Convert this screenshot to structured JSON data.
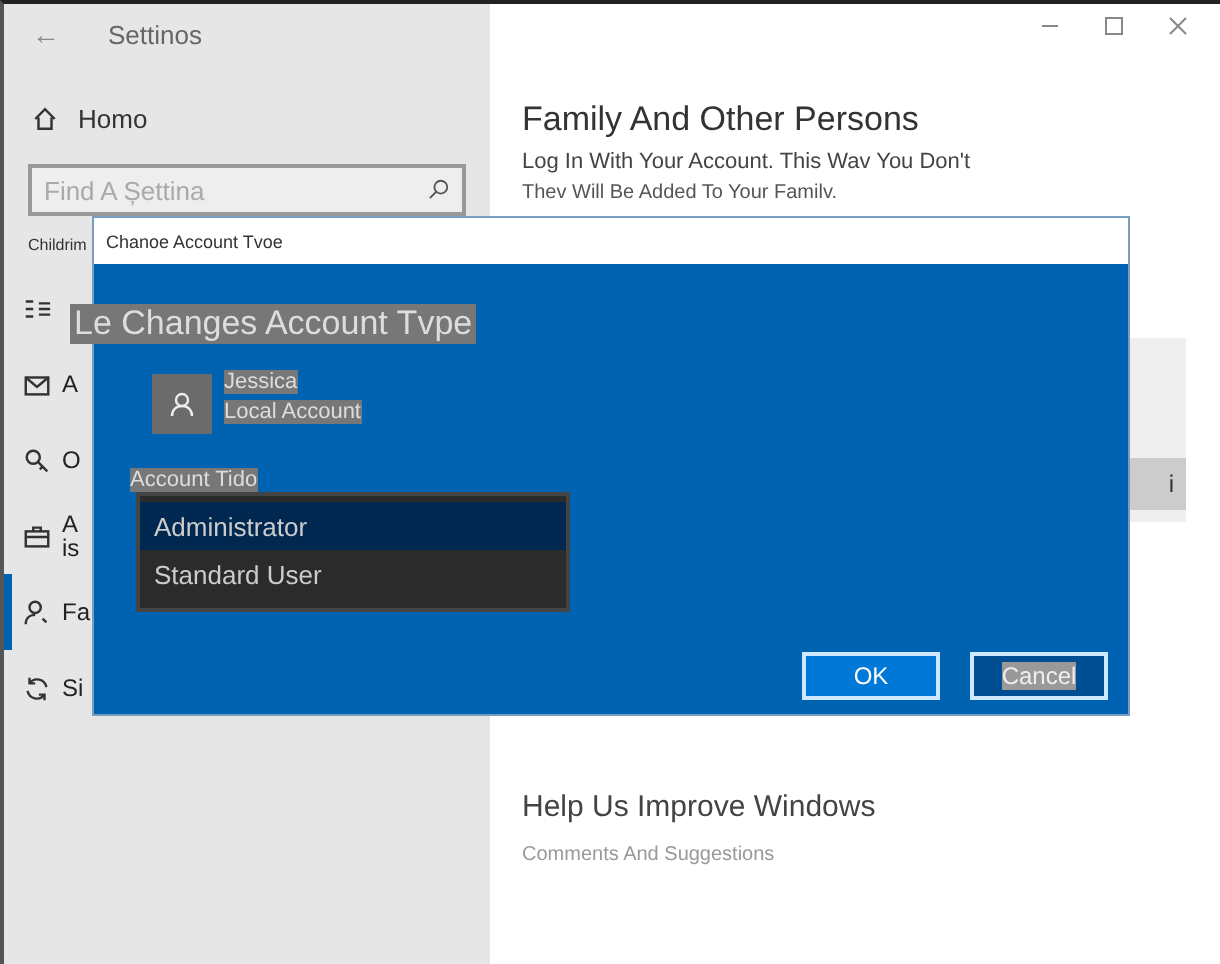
{
  "window": {
    "back": "←",
    "title": "Settinos"
  },
  "sidebar": {
    "home": "Homo",
    "search": {
      "placeholder": "Find A Șettina"
    },
    "section": "Childrim",
    "items": [
      {
        "selected": false
      },
      {
        "label": "A",
        "selected": false
      },
      {
        "label": "O",
        "selected": false
      },
      {
        "label": "A\nis",
        "selected": false
      },
      {
        "label": "Fa",
        "selected": true
      },
      {
        "label": "Si",
        "selected": false
      }
    ]
  },
  "content": {
    "title": "Family And Other Persons",
    "line1": "Log In With Your Account. This Wav You Don't",
    "line2": "Thev Will Be Added To Your Familv.",
    "side_button": "i",
    "help_title": "Help Us Improve Windows",
    "help_link": "Comments And Suggestions"
  },
  "dialog": {
    "title": "Chanoe Account Tvoe",
    "heading": "Le Changes Account Tvpe",
    "user": {
      "name": "Jessica",
      "type": "Local Account"
    },
    "field_label": "Account Tido",
    "options": [
      {
        "label": "Administrator",
        "selected": true
      },
      {
        "label": "Standard User",
        "selected": false
      }
    ],
    "buttons": [
      {
        "label": "OK",
        "kind": "primary"
      },
      {
        "label": "Cancel",
        "kind": "secondary"
      }
    ]
  }
}
